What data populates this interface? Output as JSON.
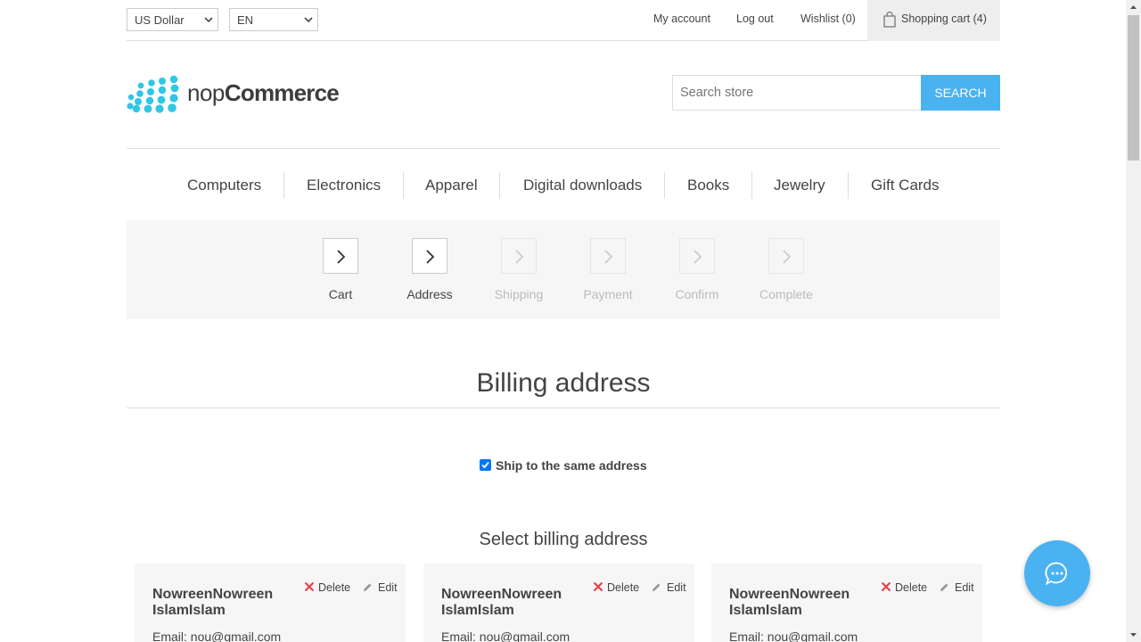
{
  "header": {
    "currency": "US Dollar",
    "language": "EN",
    "links": {
      "my_account": "My account",
      "log_out": "Log out",
      "wishlist": "Wishlist (0)",
      "cart": "Shopping cart (4)"
    }
  },
  "logo": {
    "prefix": "nop",
    "suffix": "Commerce"
  },
  "search": {
    "placeholder": "Search store",
    "button": "SEARCH"
  },
  "menu": [
    "Computers",
    "Electronics",
    "Apparel",
    "Digital downloads",
    "Books",
    "Jewelry",
    "Gift Cards"
  ],
  "steps": [
    {
      "label": "Cart",
      "active": true
    },
    {
      "label": "Address",
      "active": true
    },
    {
      "label": "Shipping",
      "active": false
    },
    {
      "label": "Payment",
      "active": false
    },
    {
      "label": "Confirm",
      "active": false
    },
    {
      "label": "Complete",
      "active": false
    }
  ],
  "page_title": "Billing address",
  "ship_same": {
    "label": "Ship to the same address",
    "checked": true
  },
  "select_title": "Select billing address",
  "addresses": [
    {
      "name": "NowreenNowreen IslamIslam",
      "email": "Email: nou@gmail.com",
      "delete": "Delete",
      "edit": "Edit"
    },
    {
      "name": "NowreenNowreen IslamIslam",
      "email": "Email: nou@gmail.com",
      "delete": "Delete",
      "edit": "Edit"
    },
    {
      "name": "NowreenNowreen IslamIslam",
      "email": "Email: nou@gmail.com",
      "delete": "Delete",
      "edit": "Edit"
    }
  ],
  "colors": {
    "accent": "#4ab2f1",
    "delete_x": "#e4434b",
    "logo_dots": "#2fc6e8"
  }
}
